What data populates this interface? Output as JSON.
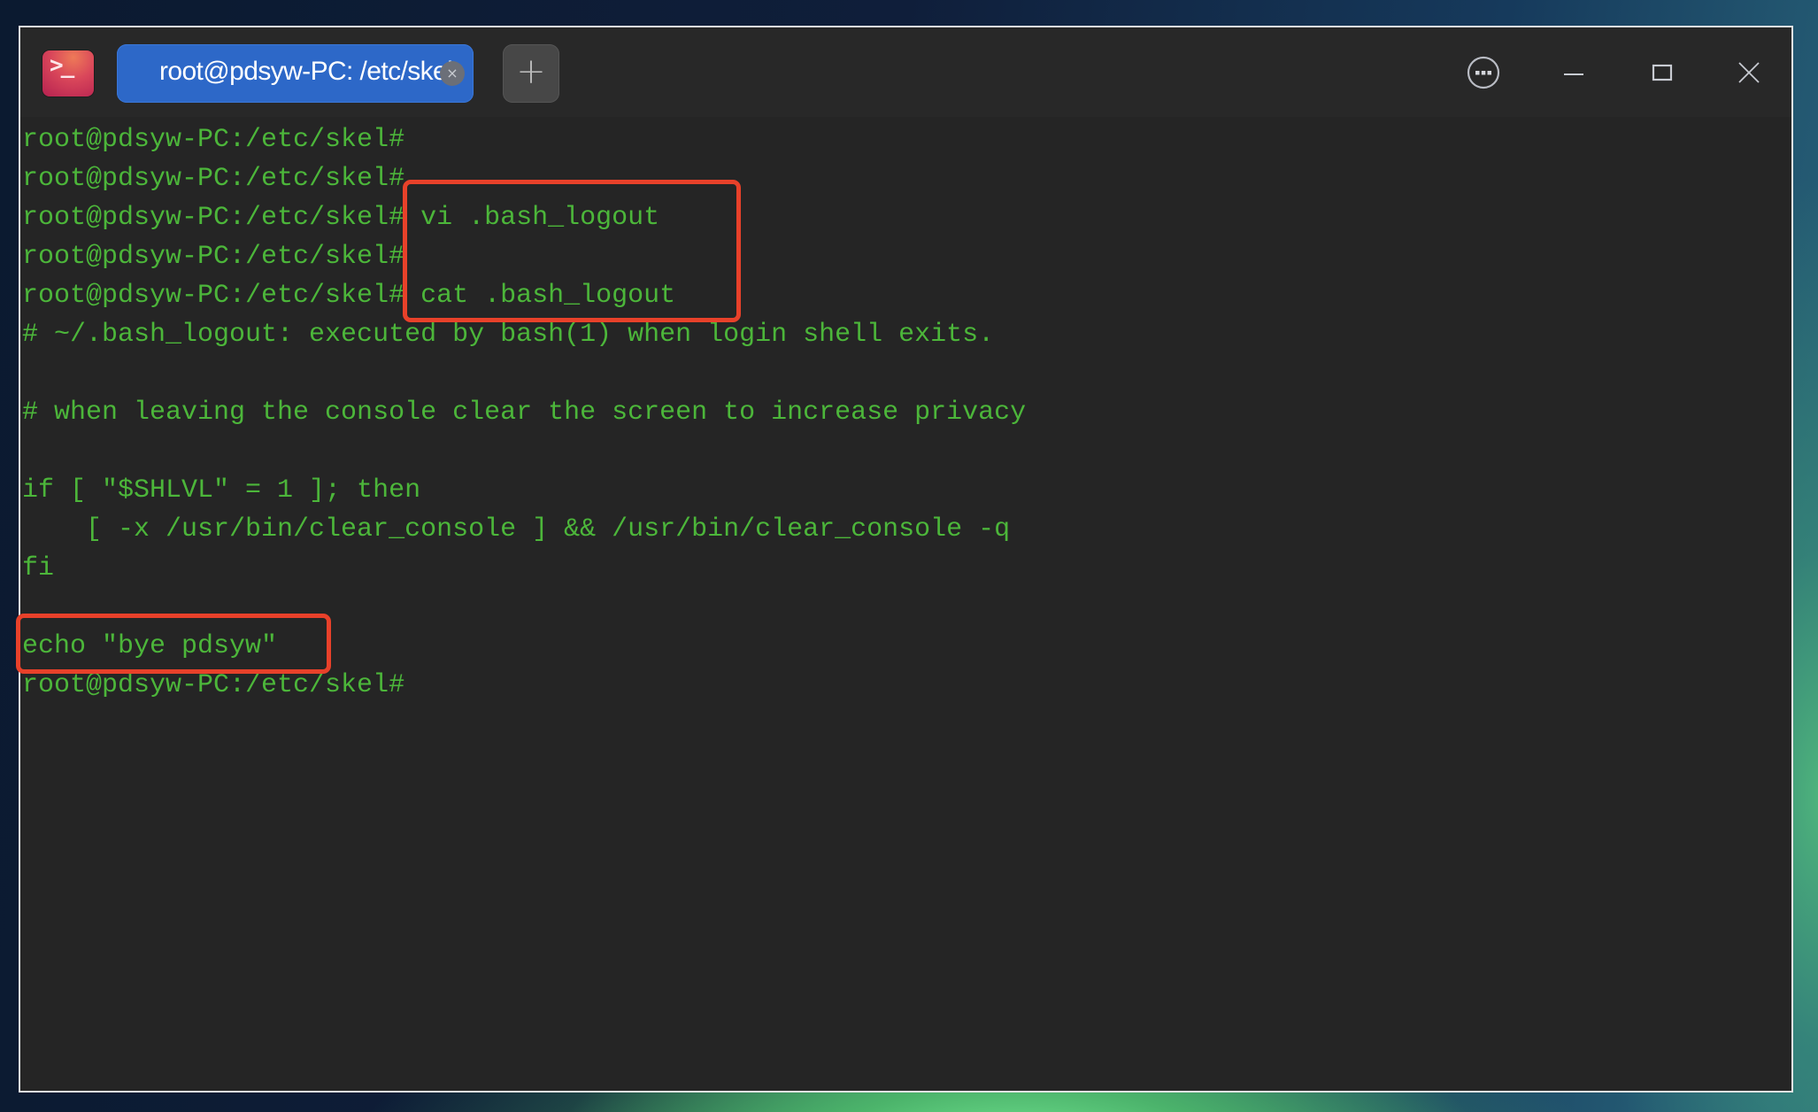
{
  "titlebar": {
    "app_icon": "terminal-icon",
    "app_icon_glyph": ">_",
    "tab": {
      "label": "root@pdsyw-PC: /etc/skel",
      "close_glyph": "×"
    },
    "new_tab_glyph": "+",
    "buttons": {
      "menu": "more-options-icon",
      "minimize": "minimize-icon",
      "maximize": "maximize-icon",
      "close": "close-icon"
    }
  },
  "terminal": {
    "lines": [
      "root@pdsyw-PC:/etc/skel#",
      "root@pdsyw-PC:/etc/skel#",
      "root@pdsyw-PC:/etc/skel# vi .bash_logout",
      "root@pdsyw-PC:/etc/skel#",
      "root@pdsyw-PC:/etc/skel# cat .bash_logout",
      "# ~/.bash_logout: executed by bash(1) when login shell exits.",
      "",
      "# when leaving the console clear the screen to increase privacy",
      "",
      "if [ \"$SHLVL\" = 1 ]; then",
      "    [ -x /usr/bin/clear_console ] && /usr/bin/clear_console -q",
      "fi",
      "",
      "echo \"bye pdsyw\"",
      "root@pdsyw-PC:/etc/skel#"
    ],
    "text_color": "#4cb63a",
    "background": "#252525",
    "highlight_color": "#e8412a"
  }
}
